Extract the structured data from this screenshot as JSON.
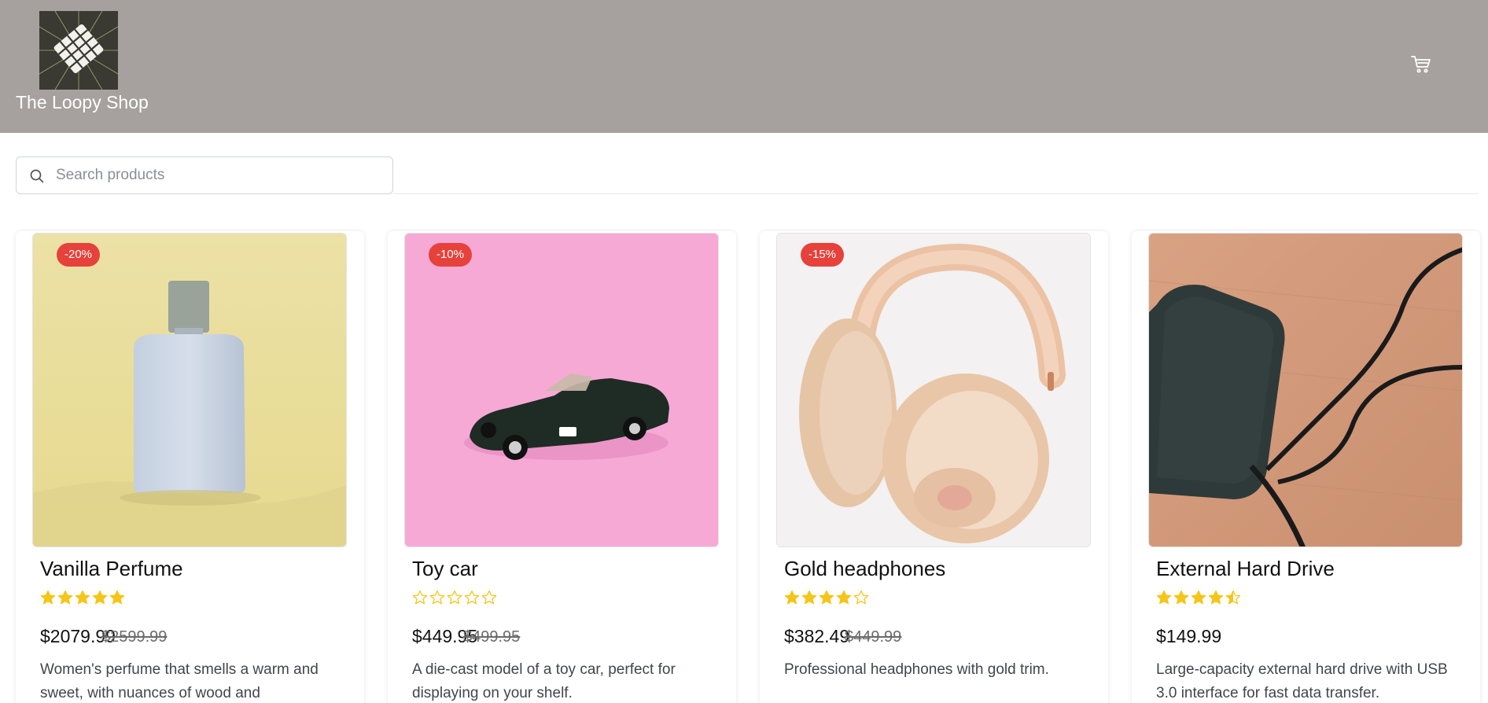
{
  "header": {
    "brand": "The Loopy Shop",
    "logo_icon": "lattice-logo",
    "cart_icon": "shopping-cart-icon",
    "background": "#a6a19e"
  },
  "search": {
    "placeholder": "Search products",
    "value": ""
  },
  "colors": {
    "badge": "#e6413a",
    "star": "#f5c518"
  },
  "products": [
    {
      "name": "Vanilla Perfume",
      "discount": "-20%",
      "rating": 5,
      "price": "$2079.99",
      "old_price": "$2599.99",
      "description": "Women's perfume that smells a warm and sweet, with nuances of wood and",
      "image": "perfume-bottle"
    },
    {
      "name": "Toy car",
      "discount": "-10%",
      "rating": 0,
      "price": "$449.95",
      "old_price": "$499.95",
      "description": "A die-cast model of a toy car, perfect for displaying on your shelf.",
      "image": "toy-car"
    },
    {
      "name": "Gold headphones",
      "discount": "-15%",
      "rating": 4,
      "price": "$382.49",
      "old_price": "$449.99",
      "description": "Professional headphones with gold trim.",
      "image": "headphones"
    },
    {
      "name": "External Hard Drive",
      "discount": "",
      "rating": 4.5,
      "price": "$149.99",
      "old_price": "",
      "description": "Large-capacity external hard drive with USB 3.0 interface for fast data transfer.",
      "image": "hard-drive"
    }
  ]
}
